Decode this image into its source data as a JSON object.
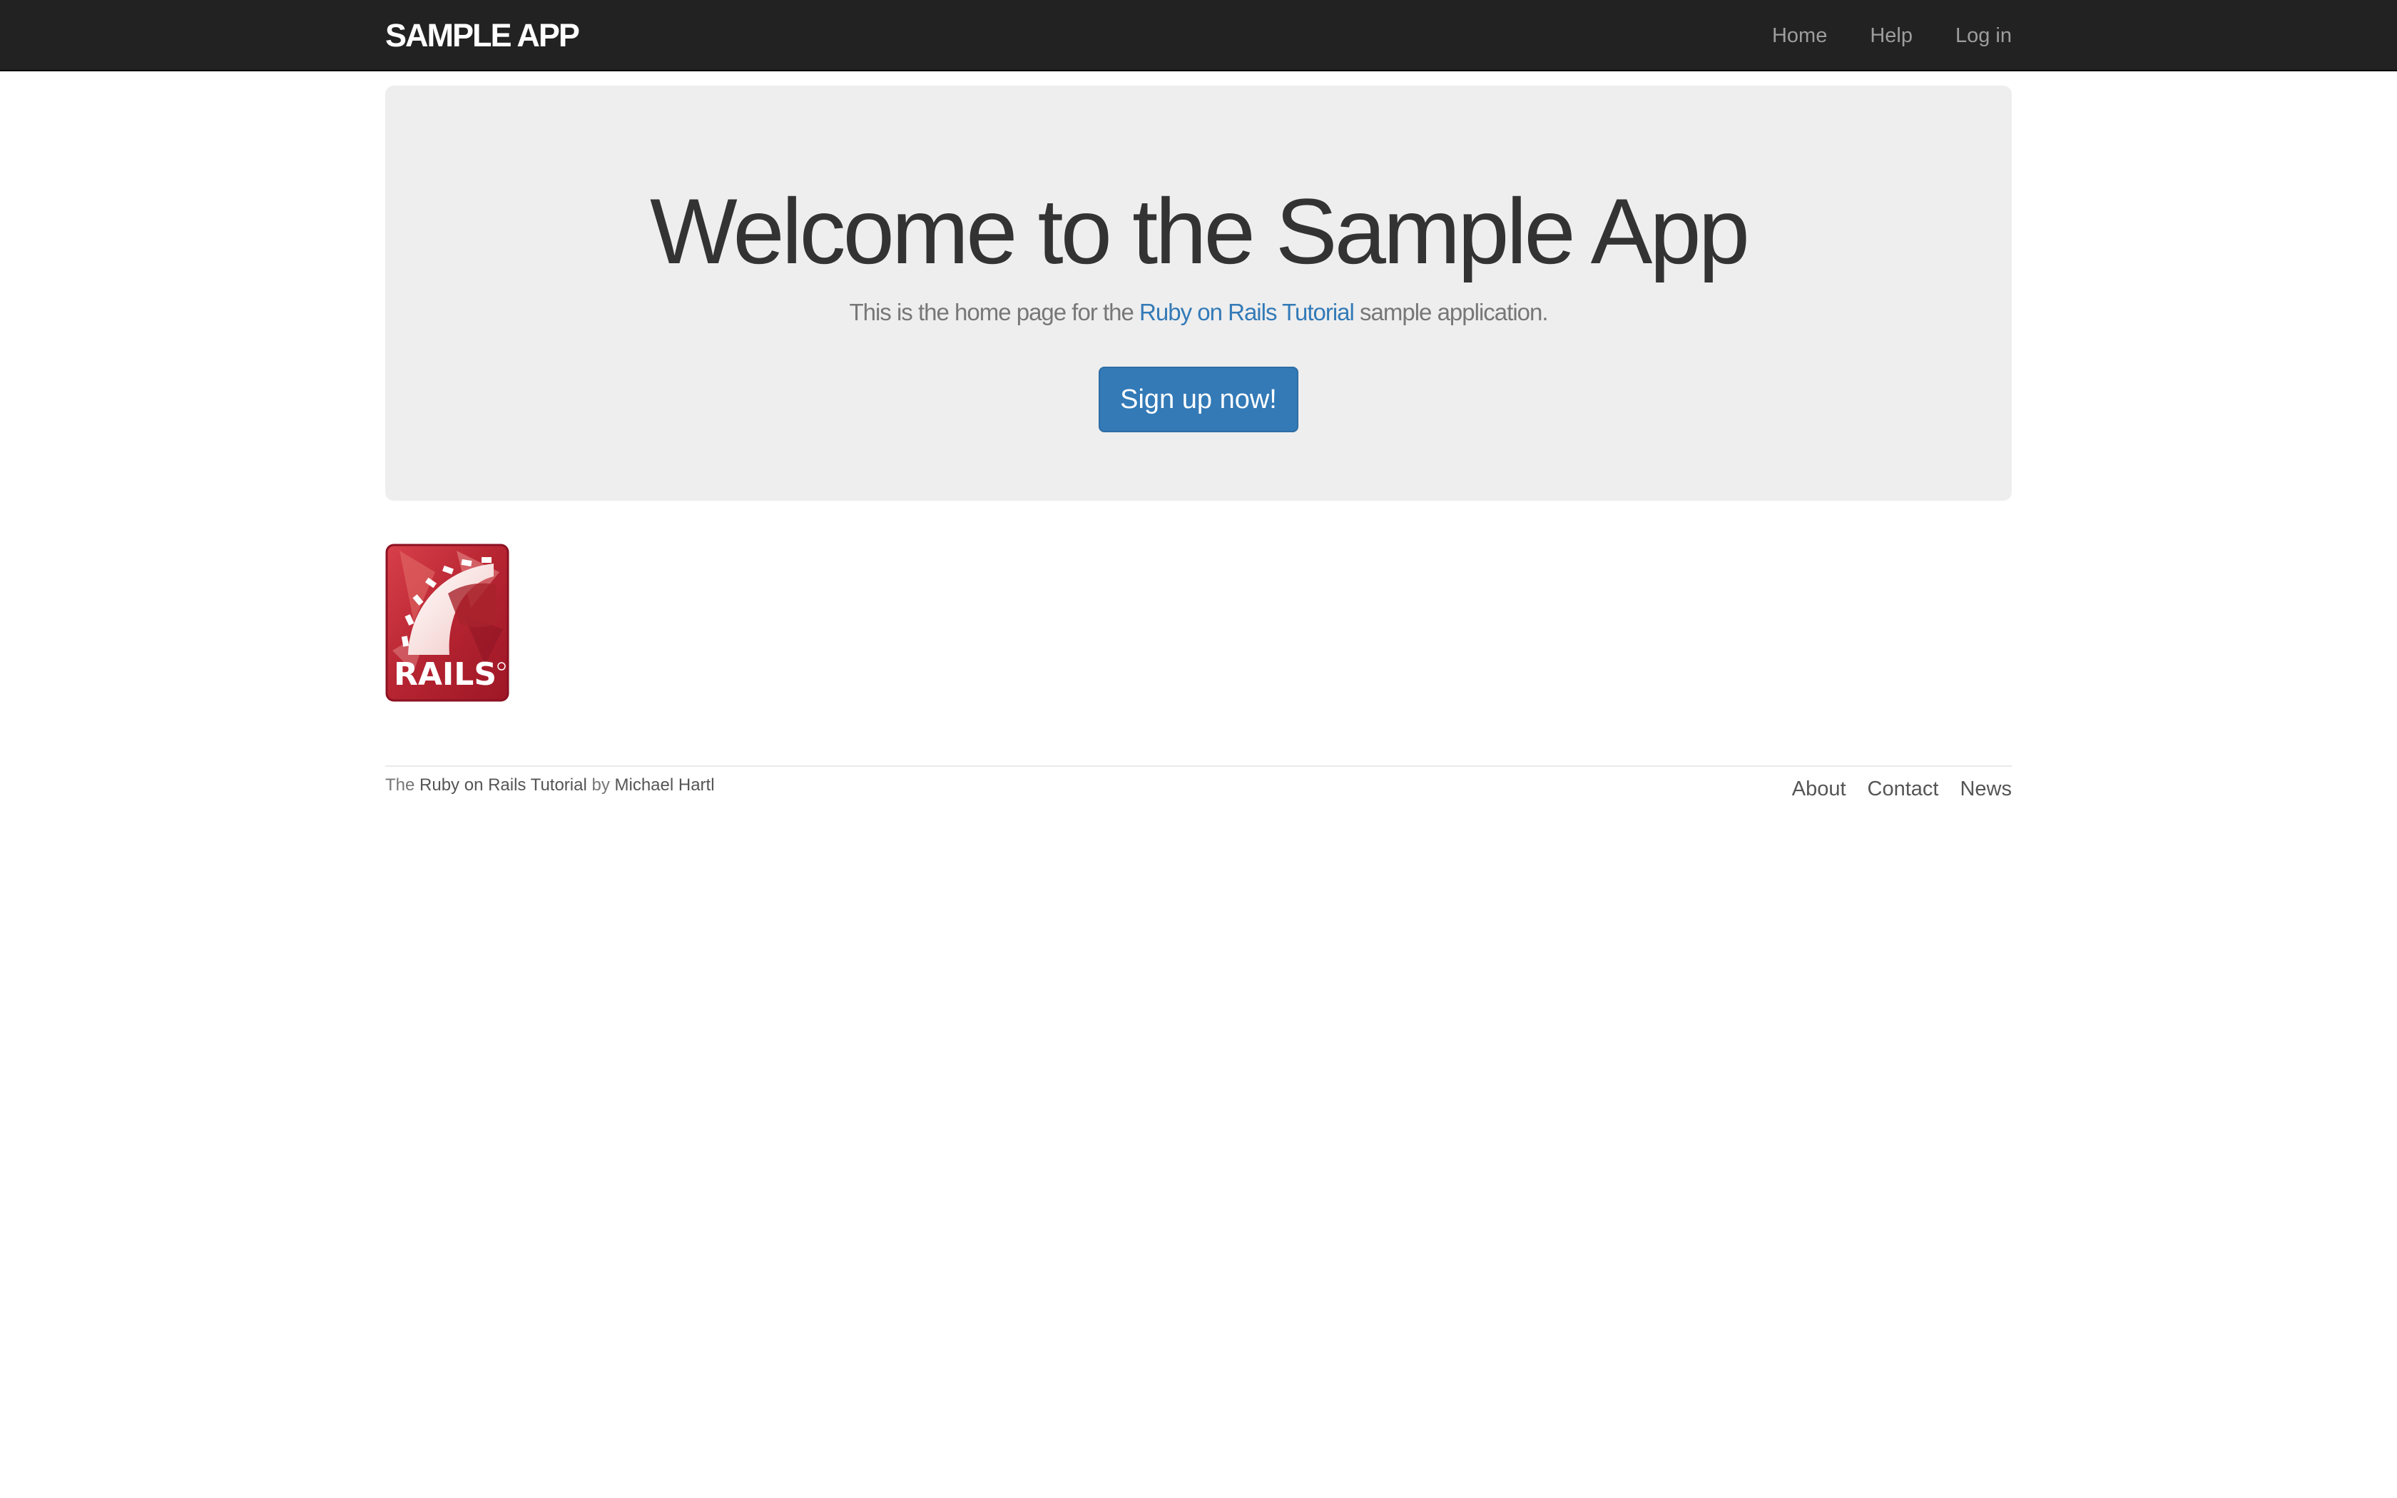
{
  "navbar": {
    "brand": "SAMPLE APP",
    "links": [
      "Home",
      "Help",
      "Log in"
    ]
  },
  "hero": {
    "title": "Welcome to the Sample App",
    "text_before": "This is the home page for the ",
    "link_text": "Ruby on Rails Tutorial",
    "text_after": " sample application.",
    "button_label": "Sign up now!"
  },
  "logo": {
    "text": "RAILS",
    "icon": "rails-logo"
  },
  "footer": {
    "prefix": "The ",
    "tutorial_link": "Ruby on Rails Tutorial",
    "by": " by ",
    "author_link": "Michael Hartl",
    "links": [
      "About",
      "Contact",
      "News"
    ]
  },
  "colors": {
    "navbar": "#222222",
    "accent": "#337ab7",
    "jumbotron": "#eeeeee",
    "rails_red": "#c1282d"
  }
}
